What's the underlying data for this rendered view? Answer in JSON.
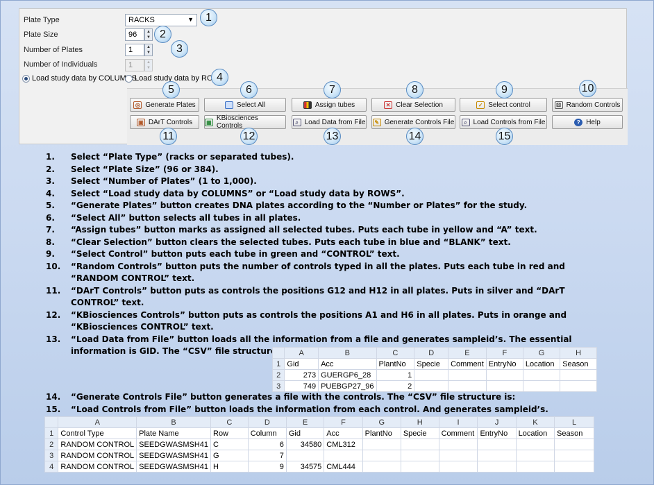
{
  "form": {
    "plate_type": {
      "label": "Plate Type",
      "value": "RACKS"
    },
    "plate_size": {
      "label": "Plate Size",
      "value": "96"
    },
    "number_of_plates": {
      "label": "Number of Plates",
      "value": "1"
    },
    "number_of_individuals": {
      "label": "Number of Individuals",
      "value": "1"
    },
    "radio_columns": "Load study data by COLUMNS",
    "radio_rows": "Load study data by ROWS"
  },
  "buttons": {
    "generate_plates": "Generate Plates",
    "select_all": "Select All",
    "assign_tubes": "Assign tubes",
    "clear_selection": "Clear Selection",
    "select_control": "Select control",
    "random_controls": "Random Controls",
    "dart_controls": "DArT Controls",
    "kbio_controls": "KBiosciences Controls",
    "load_data": "Load Data from File",
    "generate_controls_file": "Generate Controls File",
    "load_controls": "Load Controls from File",
    "help": "Help"
  },
  "callouts": [
    "1",
    "2",
    "3",
    "4",
    "5",
    "6",
    "7",
    "8",
    "9",
    "10",
    "11",
    "12",
    "13",
    "14",
    "15"
  ],
  "steps": [
    {
      "n": "1.",
      "t": "Select “Plate Type” (racks or separated tubes)."
    },
    {
      "n": "2.",
      "t": "Select “Plate Size” (96 or 384)."
    },
    {
      "n": "3.",
      "t": "Select “Number of Plates” (1 to 1,000)."
    },
    {
      "n": "4.",
      "t": "Select “Load study data by COLUMNS” or “Load study data by ROWS”."
    },
    {
      "n": "5.",
      "t": "“Generate Plates” button creates DNA plates according to the “Number or Plates” for the study."
    },
    {
      "n": "6.",
      "t": "“Select All” button selects all tubes in all plates."
    },
    {
      "n": "7.",
      "t": "“Assign tubes” button marks as assigned all selected tubes. Puts each tube in yellow and “A” text."
    },
    {
      "n": "8.",
      "t": "“Clear Selection” button clears the selected tubes. Puts each tube in blue and “BLANK” text."
    },
    {
      "n": "9.",
      "t": "“Select Control” button puts each tube in green and “CONTROL” text."
    },
    {
      "n": "10.",
      "t": "“Random Controls” button puts the number of controls typed in all the plates. Puts each tube in red and “RANDOM CONTROL” text."
    },
    {
      "n": "11.",
      "t": "“DArT Controls” button puts as controls the positions G12 and H12 in all plates. Puts in silver and “DArT CONTROL” text."
    },
    {
      "n": "12.",
      "t": "“KBiosciences Controls” button puts as controls the positions A1 and H6 in all plates. Puts in orange and “KBiosciences CONTROL” text."
    },
    {
      "n": "13.",
      "t": "“Load Data from File” button loads all the information from a file and generates sampleid’s. The essential information is GID.  The “CSV” file structure is:"
    },
    {
      "n": "14.",
      "t": "“Generate Controls File” button generates a file with the controls. The “CSV” file structure is:"
    },
    {
      "n": "15.",
      "t": "“Load Controls from File” button loads the information from each control. And generates sampleid’s."
    }
  ],
  "sheet1": {
    "cols": [
      "A",
      "B",
      "C",
      "D",
      "E",
      "F",
      "G",
      "H"
    ],
    "rows": [
      {
        "rh": "1",
        "cells": [
          "Gid",
          "Acc",
          "PlantNo",
          "Specie",
          "Comment",
          "EntryNo",
          "Location",
          "Season"
        ]
      },
      {
        "rh": "2",
        "cells": [
          "273",
          "GUERGP6_28",
          "1",
          "",
          "",
          "",
          "",
          ""
        ]
      },
      {
        "rh": "3",
        "cells": [
          "749",
          "PUEBGP27_96",
          "2",
          "",
          "",
          "",
          "",
          ""
        ]
      }
    ]
  },
  "sheet2": {
    "cols": [
      "A",
      "B",
      "C",
      "D",
      "E",
      "F",
      "G",
      "H",
      "I",
      "J",
      "K",
      "L"
    ],
    "rows": [
      {
        "rh": "1",
        "cells": [
          "Control Type",
          "Plate Name",
          "Row",
          "Column",
          "Gid",
          "Acc",
          "PlantNo",
          "Specie",
          "Comment",
          "EntryNo",
          "Location",
          "Season"
        ]
      },
      {
        "rh": "2",
        "cells": [
          "RANDOM CONTROL",
          "SEEDGWASMSH41",
          "C",
          "6",
          "34580",
          "CML312",
          "",
          "",
          "",
          "",
          "",
          ""
        ]
      },
      {
        "rh": "3",
        "cells": [
          "RANDOM CONTROL",
          "SEEDGWASMSH41",
          "G",
          "7",
          "",
          "",
          "",
          "",
          "",
          "",
          "",
          ""
        ]
      },
      {
        "rh": "4",
        "cells": [
          "RANDOM CONTROL",
          "SEEDGWASMSH41",
          "H",
          "9",
          "34575",
          "CML444",
          "",
          "",
          "",
          "",
          "",
          ""
        ]
      }
    ]
  }
}
